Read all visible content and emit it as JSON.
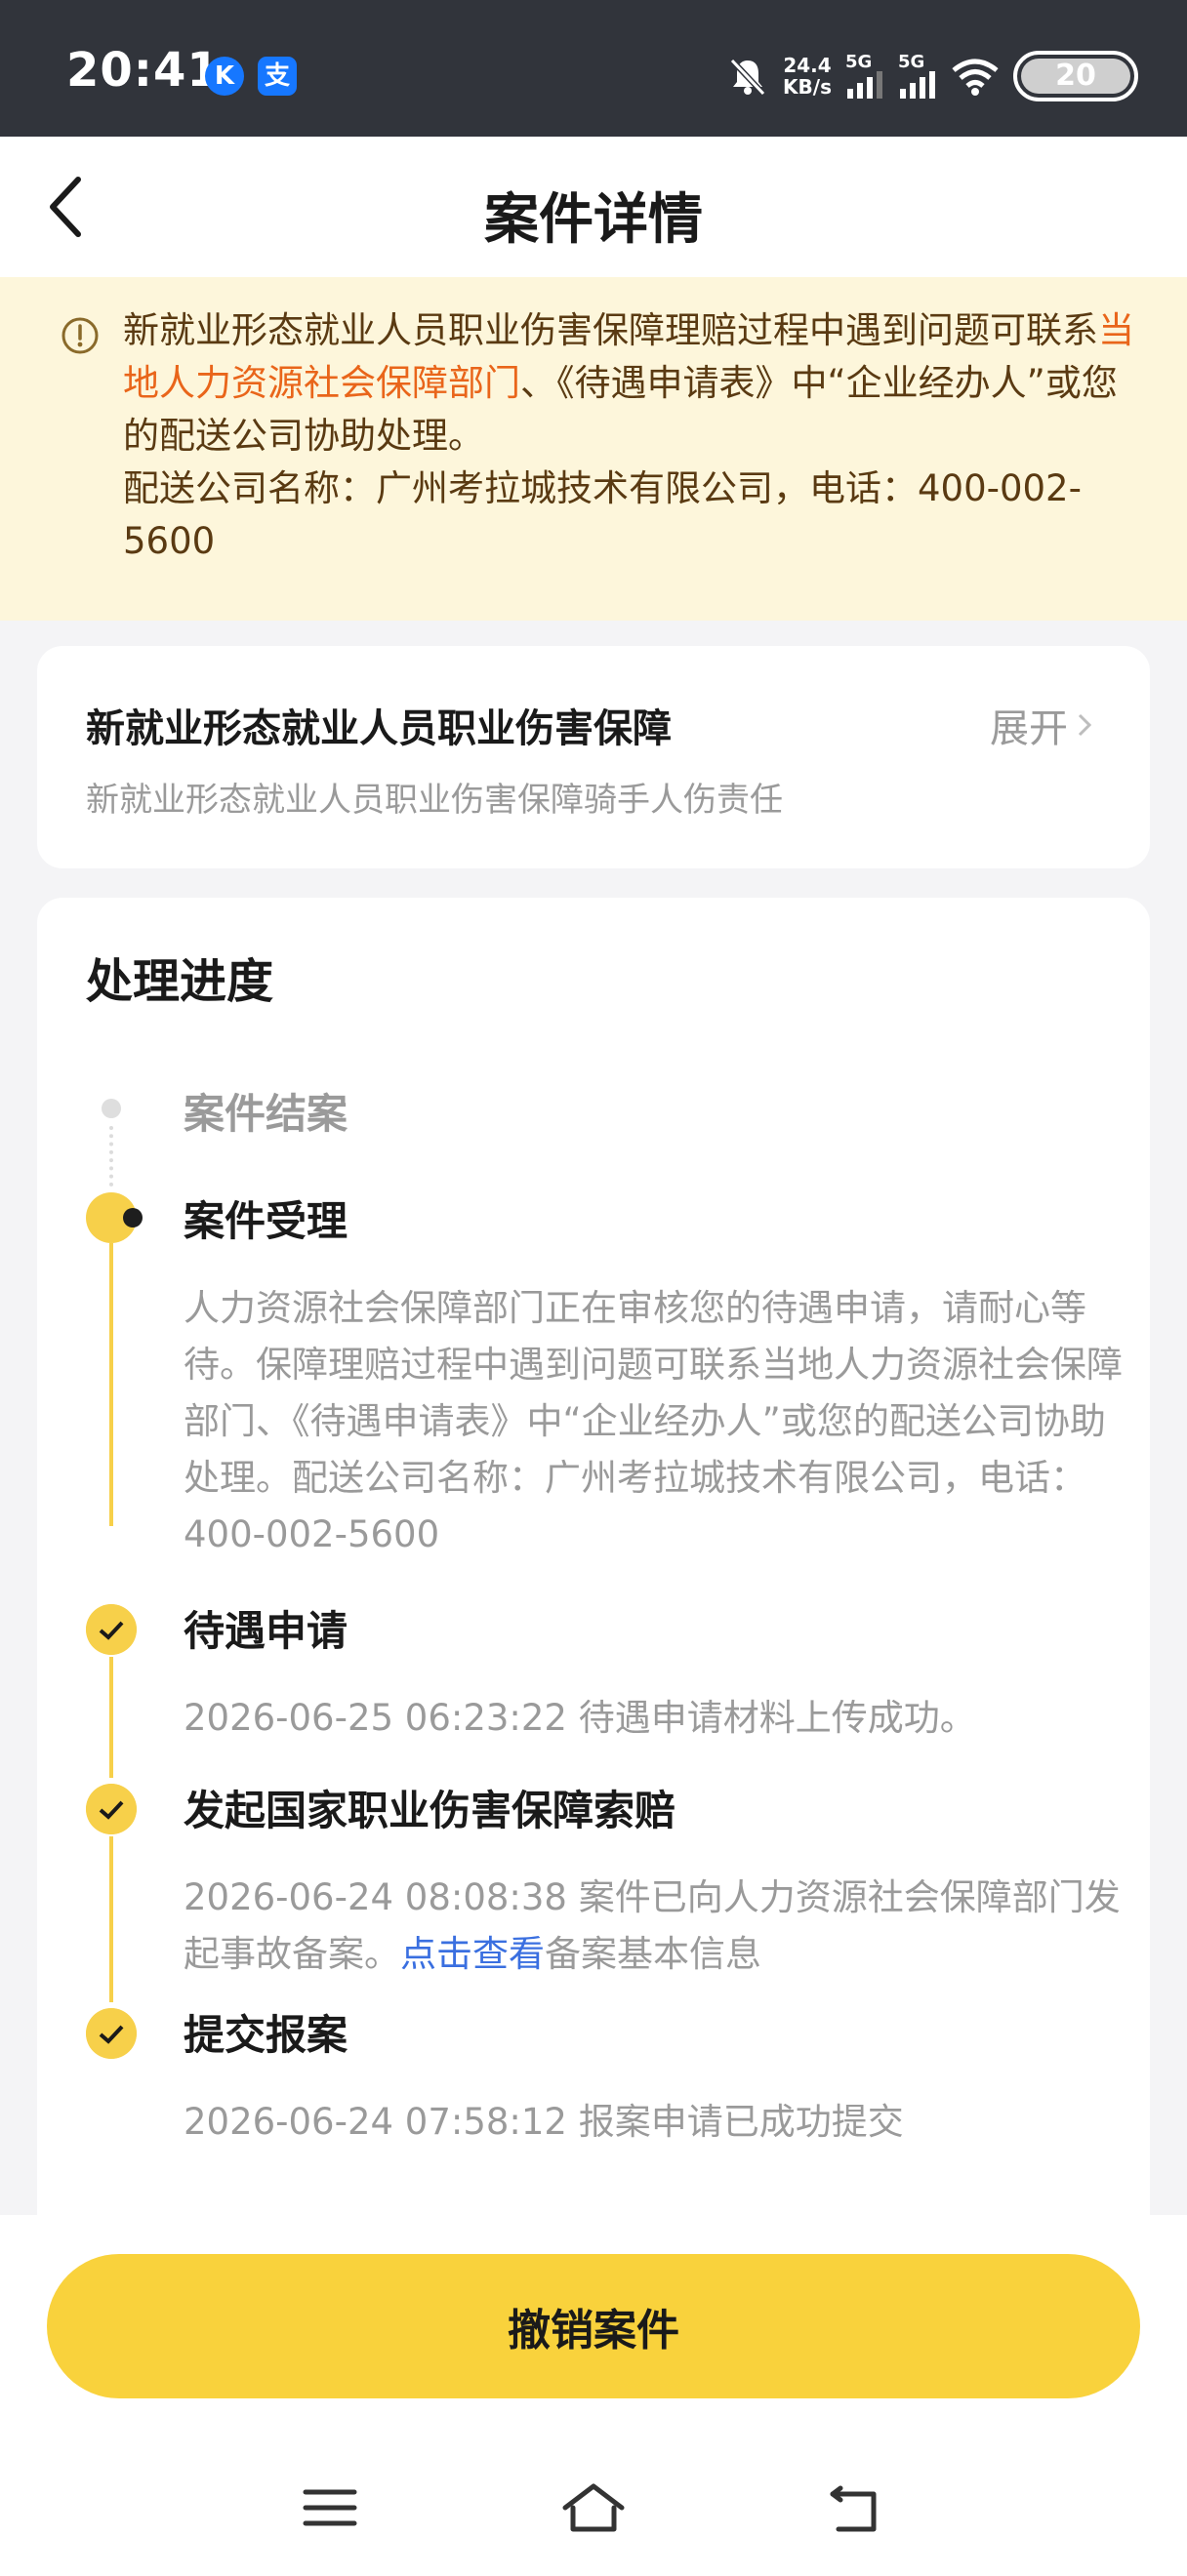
{
  "status_bar": {
    "time": "20:41",
    "app_icons": [
      "K",
      "支"
    ],
    "net_speed_value": "24.4",
    "net_speed_unit": "KB/s",
    "signal1_label": "5G",
    "signal2_label": "5G",
    "battery": "20"
  },
  "header": {
    "title": "案件详情"
  },
  "notice": {
    "text_part1": "新就业形态就业人员职业伤害保障理赔过程中遇到问题可联系",
    "text_highlight": "当地人力资源社会保障部门",
    "text_part2": "、《待遇申请表》中“企业经办人”或您的配送公司协助处理。",
    "company_line": "配送公司名称：广州考拉城技术有限公司，电话：400-002-5600",
    "highlight_color": "#e9651a"
  },
  "policy_card": {
    "title": "新就业形态就业人员职业伤害保障",
    "subtitle": "新就业形态就业人员职业伤害保障骑手人伤责任",
    "expand_label": "展开"
  },
  "progress": {
    "title": "处理进度",
    "steps": [
      {
        "title": "案件结案",
        "state": "pending"
      },
      {
        "title": "案件受理",
        "state": "current",
        "desc": "人力资源社会保障部门正在审核您的待遇申请，请耐心等待。保障理赔过程中遇到问题可联系当地人力资源社会保障部门、《待遇申请表》中“企业经办人”或您的配送公司协助处理。配送公司名称：广州考拉城技术有限公司，电话：400-002-5600"
      },
      {
        "title": "待遇申请",
        "state": "done",
        "desc": "2026-06-25 06:23:22 待遇申请材料上传成功。"
      },
      {
        "title": "发起国家职业伤害保障索赔",
        "state": "done",
        "desc_prefix": "2026-06-24 08:08:38 案件已向人力资源社会保障部门发起事故备案。",
        "link": "点击查看",
        "desc_suffix": "备案基本信息"
      },
      {
        "title": "提交报案",
        "state": "done",
        "desc": "2026-06-24 07:58:12 报案申请已成功提交"
      }
    ]
  },
  "actions": {
    "cancel_label": "撤销案件"
  },
  "colors": {
    "accent": "#f9d23c",
    "link": "#3a6fe0",
    "notice_bg": "#fdf6db"
  }
}
